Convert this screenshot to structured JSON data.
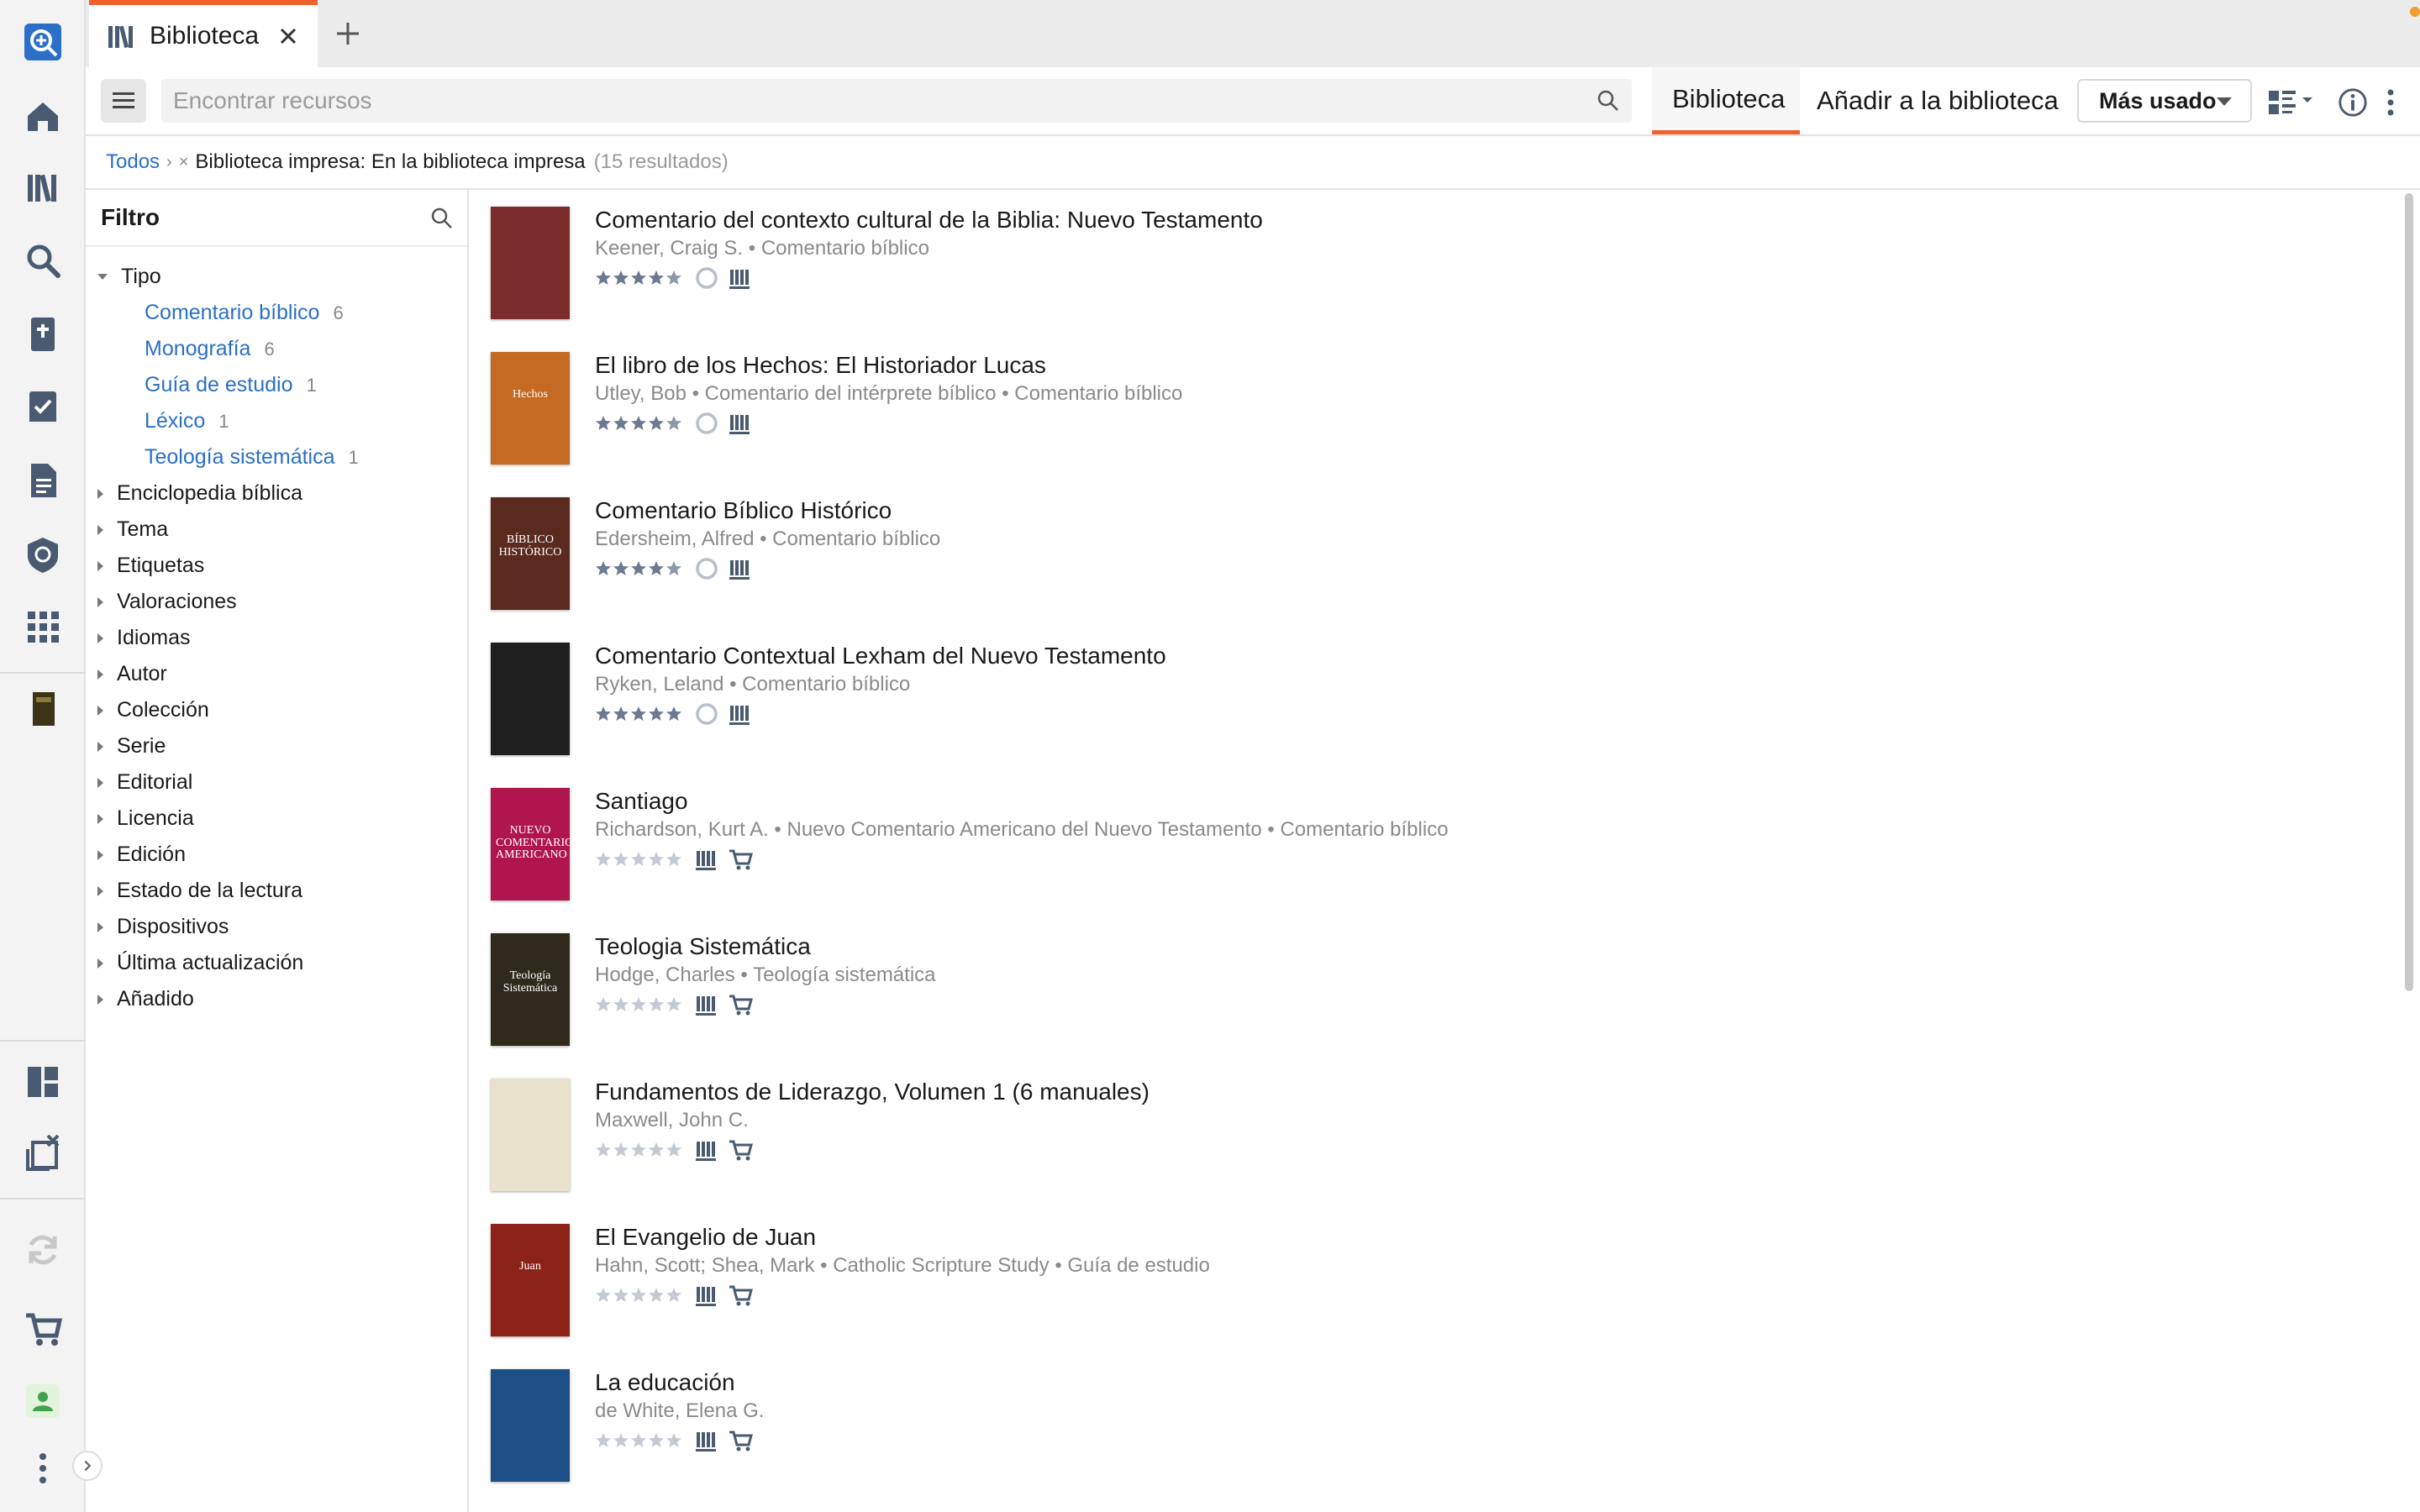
{
  "tab": {
    "title": "Biblioteca"
  },
  "toolbar": {
    "search_placeholder": "Encontrar recursos",
    "tab_library": "Biblioteca",
    "tab_add": "Añadir a la biblioteca",
    "sort_label": "Más usado"
  },
  "breadcrumb": {
    "root": "Todos",
    "current": "Biblioteca impresa: En la biblioteca impresa",
    "count": "(15 resultados)"
  },
  "filter": {
    "title": "Filtro",
    "open_group": "Tipo",
    "type_items": [
      {
        "label": "Comentario bíblico",
        "count": "6"
      },
      {
        "label": "Monografía",
        "count": "6"
      },
      {
        "label": "Guía de estudio",
        "count": "1"
      },
      {
        "label": "Léxico",
        "count": "1"
      },
      {
        "label": "Teología sistemática",
        "count": "1"
      }
    ],
    "groups": [
      "Enciclopedia bíblica",
      "Tema",
      "Etiquetas",
      "Valoraciones",
      "Idiomas",
      "Autor",
      "Colección",
      "Serie",
      "Editorial",
      "Licencia",
      "Edición",
      "Estado de la lectura",
      "Dispositivos",
      "Última actualización",
      "Añadido"
    ]
  },
  "results": [
    {
      "title": "Comentario del contexto cultural de la Biblia: Nuevo Testamento",
      "meta": "Keener, Craig S. • Comentario bíblico",
      "rating": 4.5,
      "owned": true,
      "cover_color": "#7a2d2a",
      "cover_text": ""
    },
    {
      "title": "El libro de los Hechos: El Historiador Lucas",
      "meta": "Utley, Bob • Comentario del intérprete bíblico • Comentario bíblico",
      "rating": 4.5,
      "owned": true,
      "cover_color": "#c46a22",
      "cover_text": "Hechos"
    },
    {
      "title": "Comentario Bíblico Histórico",
      "meta": "Edersheim, Alfred • Comentario bíblico",
      "rating": 4.5,
      "owned": true,
      "cover_color": "#5a2a1e",
      "cover_text": "BÍBLICO HISTÓRICO"
    },
    {
      "title": "Comentario Contextual Lexham del Nuevo Testamento",
      "meta": "Ryken, Leland • Comentario bíblico",
      "rating": 5,
      "owned": true,
      "cover_color": "#1f1f1f",
      "cover_text": ""
    },
    {
      "title": "Santiago",
      "meta": "Richardson, Kurt A. • Nuevo Comentario Americano del Nuevo Testamento • Comentario bíblico",
      "rating": 0,
      "owned": false,
      "cover_color": "#b0154e",
      "cover_text": "NUEVO COMENTARIO AMERICANO"
    },
    {
      "title": "Teologia Sistemática",
      "meta": "Hodge, Charles • Teología sistemática",
      "rating": 0,
      "owned": false,
      "cover_color": "#2f2a1c",
      "cover_text": "Teología Sistemática"
    },
    {
      "title": "Fundamentos de Liderazgo, Volumen 1 (6 manuales)",
      "meta": "Maxwell, John C.",
      "rating": 0,
      "owned": false,
      "cover_color": "#e8e2cc",
      "cover_text": ""
    },
    {
      "title": "El Evangelio de Juan",
      "meta": "Hahn, Scott; Shea, Mark • Catholic Scripture Study • Guía de estudio",
      "rating": 0,
      "owned": false,
      "cover_color": "#8c2318",
      "cover_text": "Juan"
    },
    {
      "title": "La educación",
      "meta": "de White, Elena G.",
      "rating": 0,
      "owned": false,
      "cover_color": "#1d4f86",
      "cover_text": ""
    }
  ]
}
